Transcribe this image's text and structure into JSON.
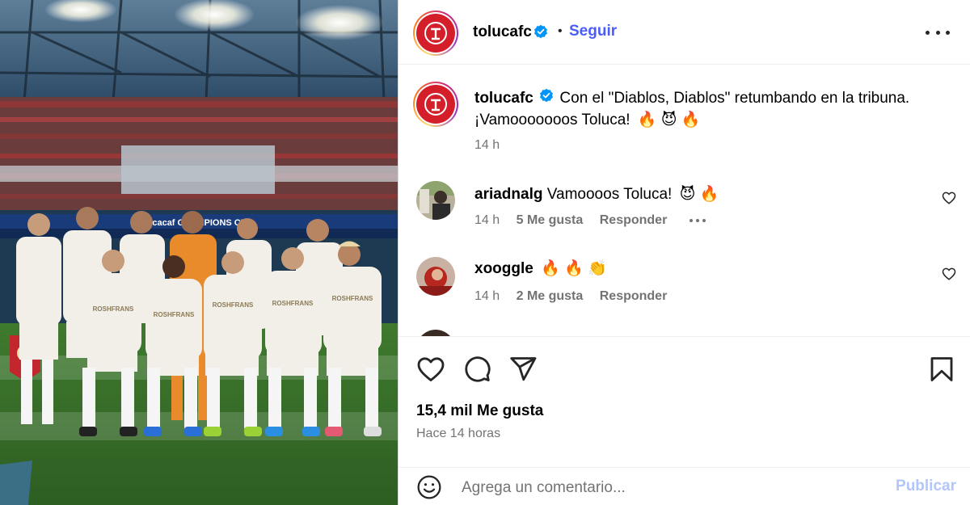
{
  "post": {
    "username": "tolucafc",
    "follow_label": "Seguir",
    "separator": "•",
    "caption_line1": "Con el \"Diablos, Diablos\" retumbando en la tribuna.",
    "caption_line2": "¡Vamooooooos Toluca!",
    "caption_emojis": "🔥 😈 🔥",
    "caption_time": "14 h",
    "likes": "15,4 mil Me gusta",
    "date": "Hace 14 horas"
  },
  "comments": [
    {
      "username": "ariadnalg",
      "text": "Vamoooos Toluca!",
      "emojis": "😈 🔥",
      "time": "14 h",
      "likes": "5 Me gusta",
      "reply": "Responder"
    },
    {
      "username": "xoogglе",
      "text": "",
      "emojis": "🔥 🔥 👏",
      "time": "14 h",
      "likes": "2 Me gusta",
      "reply": "Responder"
    }
  ],
  "comment_bar": {
    "placeholder": "Agrega un comentario...",
    "publish_label": "Publicar"
  },
  "photo": {
    "banner_text": "Concacaf CHAMPIONS CUP",
    "jersey_sponsor": "ROSHFRANS"
  },
  "colors": {
    "accent": "#4a5df9",
    "club_red": "#d41f2b",
    "publish_disabled": "#b2c6fb",
    "meta_gray": "#737373"
  }
}
